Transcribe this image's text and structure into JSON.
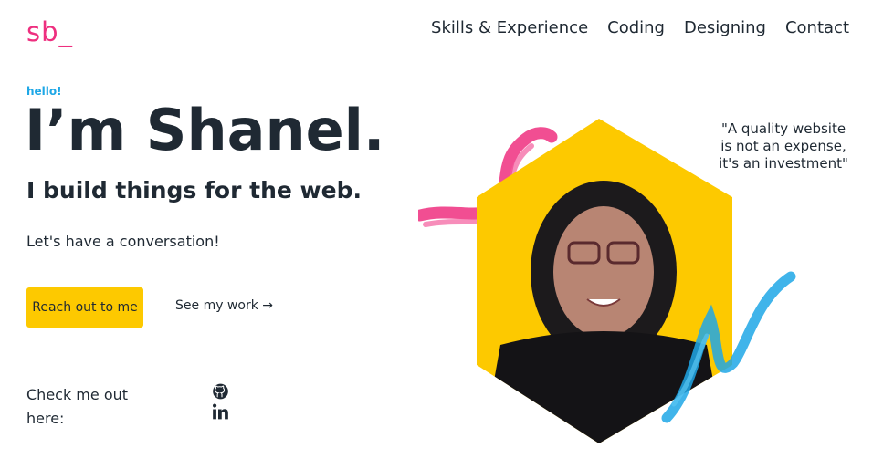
{
  "header": {
    "logo": "sb_",
    "nav": [
      "Skills & Experience",
      "Coding",
      "Designing",
      "Contact"
    ]
  },
  "hero": {
    "greeting": "hello!",
    "headline": "I’m Shanel.",
    "subhead": "I build things for the web.",
    "tagline": "Let's have a conversation!",
    "primary_button": "Reach out to me",
    "secondary_link": "See my work →"
  },
  "social": {
    "label": "Check me out here:",
    "icons": [
      "github-icon",
      "linkedin-icon"
    ]
  },
  "quote": {
    "lines": [
      "\"A quality website",
      "is not an expense,",
      "it's an investment\""
    ]
  },
  "colors": {
    "brand_pink": "#ee2f7f",
    "accent_blue": "#1ea7e6",
    "accent_yellow": "#fdc900",
    "text": "#1f2933"
  }
}
